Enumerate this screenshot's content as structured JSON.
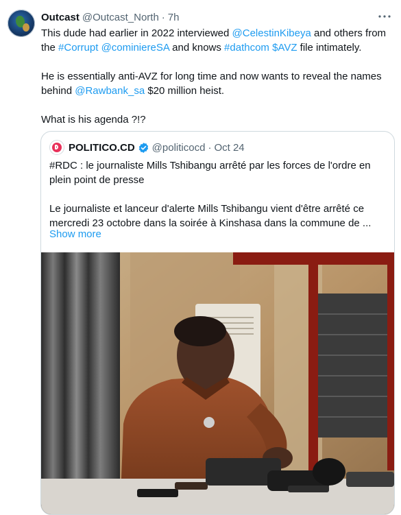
{
  "tweet": {
    "author_name": "Outcast",
    "author_handle": "@Outcast_North",
    "separator": "·",
    "time": "7h",
    "more_icon": "ellipsis-icon",
    "text": {
      "p1_a": "This dude had earlier in 2022 interviewed ",
      "p1_mention1": "@CelestinKibeya",
      "p1_b": " and others from the ",
      "p1_tag1": "#Corrupt",
      "p1_c": " ",
      "p1_mention2": "@cominiereSA",
      "p1_d": " and knows ",
      "p1_tag2": "#dathcom",
      "p1_e": " ",
      "p1_cashtag": "$AVZ",
      "p1_f": " file intimately.",
      "p2_a": "He is essentially anti-AVZ for long time and now wants to reveal the names behind ",
      "p2_mention": "@Rawbank_sa",
      "p2_b": " $20 million heist.",
      "p3": "What is his agenda ?!?"
    }
  },
  "quote": {
    "author_name": "POLITICO.CD",
    "author_handle": "@politicocd",
    "separator": "·",
    "date": "Oct 24",
    "verified_icon": "verified-badge-icon",
    "text_p1": "#RDC : le journaliste Mills Tshibangu arrêté par les forces de l'ordre en plein point de presse",
    "text_p2": "Le journaliste et lanceur d'alerte Mills Tshibangu vient d'être arrêté ce mercredi 23 octobre dans la soirée à Kinshasa dans la commune de ...",
    "show_more": "Show more"
  },
  "colors": {
    "link": "#1d9bf0",
    "text": "#0f1419",
    "secondary": "#536471",
    "border": "#cfd9de",
    "politico_brand": "#e8315a"
  }
}
